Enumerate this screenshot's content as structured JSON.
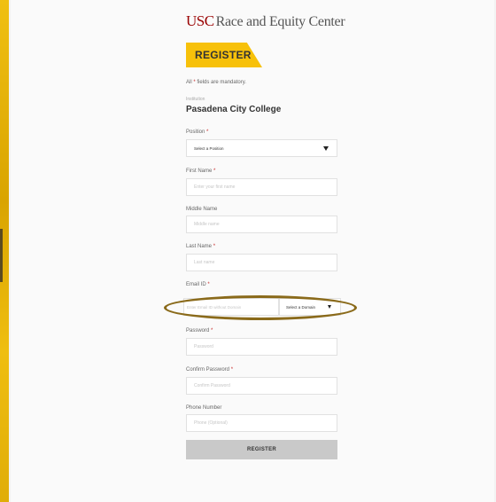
{
  "logo": {
    "primary": "USC",
    "secondary": "Race and Equity Center"
  },
  "banner": {
    "title": "REGISTER"
  },
  "notice": {
    "prefix": "All ",
    "star": "*",
    "suffix": " fields are mandatory."
  },
  "institution": {
    "label": "Institution",
    "value": "Pasadena City College"
  },
  "fields": {
    "position": {
      "label": "Position",
      "value": "Select a Position"
    },
    "first_name": {
      "label": "First Name",
      "placeholder": "Enter your first name"
    },
    "middle_name": {
      "label": "Middle Name",
      "placeholder": "Middle name"
    },
    "last_name": {
      "label": "Last Name",
      "placeholder": "Last name"
    },
    "email": {
      "label": "Email ID",
      "placeholder": "Enter Email ID without Domain",
      "domain_value": "Select a Domain"
    },
    "password": {
      "label": "Password",
      "placeholder": "Password"
    },
    "confirm_password": {
      "label": "Confirm Password",
      "placeholder": "Confirm Password"
    },
    "phone": {
      "label": "Phone Number",
      "placeholder": "Phone (Optional)"
    }
  },
  "required_mark": "*",
  "submit": {
    "label": "REGISTER"
  },
  "colors": {
    "accent_yellow": "#f7c10a",
    "brand_red": "#990000",
    "highlight": "#8a6a1a"
  }
}
